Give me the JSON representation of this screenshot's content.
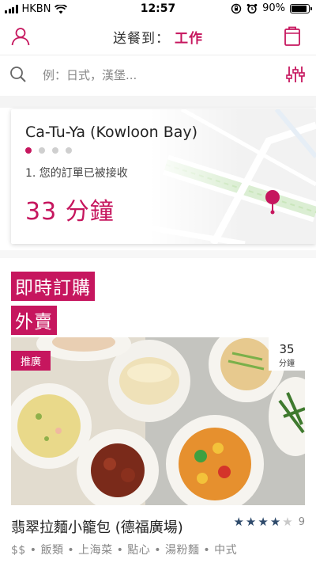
{
  "status_bar": {
    "carrier": "HKBN",
    "time": "12:57",
    "battery": "90%",
    "battery_level": 0.9
  },
  "header": {
    "deliver_label": "送餐到：",
    "location": "工作"
  },
  "search": {
    "placeholder": "例：日式，漢堡..."
  },
  "order": {
    "restaurant": "Ca-Tu-Ya (Kowloon Bay)",
    "progress_steps": 4,
    "current_step": 1,
    "status": "1. 您的訂單已被接收",
    "eta": "33 分鐘"
  },
  "promo": {
    "line1": "即時訂購",
    "line2": "外賣"
  },
  "restaurant_card": {
    "badge": "推廣",
    "eta_number": "35",
    "eta_unit": "分鐘",
    "name": "翡翠拉麵小籠包 (德福廣場)",
    "rating": 4,
    "rating_max": 5,
    "rating_count": "9",
    "tags": "$$ • 飯類 • 上海菜 • 點心 • 湯粉麵 • 中式"
  },
  "colors": {
    "brand": "#c6165e",
    "star": "#2e4a6b"
  },
  "icons": [
    "wifi-icon",
    "signal-icon",
    "lock-rotation-icon",
    "alarm-icon",
    "battery-icon",
    "user-icon",
    "bag-icon",
    "search-icon",
    "filter-icon",
    "map-pin-icon"
  ]
}
